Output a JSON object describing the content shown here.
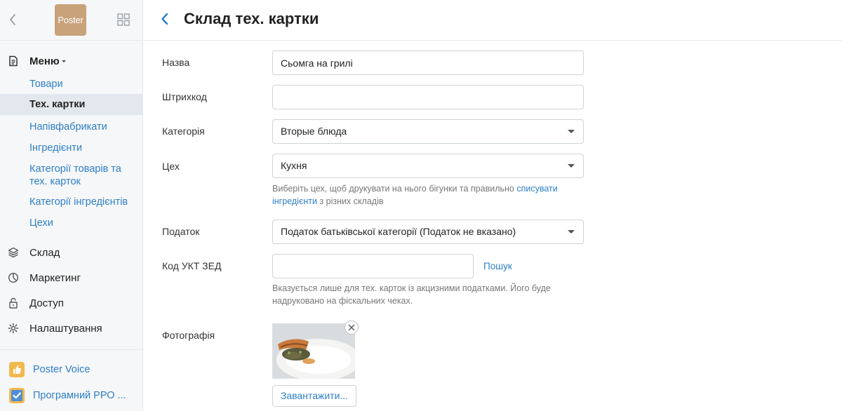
{
  "sidebar": {
    "logo_text": "Poster",
    "sections": {
      "menu": "Меню",
      "warehouse": "Склад",
      "marketing": "Маркетинг",
      "access": "Доступ",
      "settings": "Налаштування"
    },
    "menu_items": [
      "Товари",
      "Тех. картки",
      "Напівфабрикати",
      "Інгредієнти",
      "Категорії товарів та тех. карток",
      "Категорії інгредієнтів",
      "Цехи"
    ],
    "active_item": "Тех. картки",
    "apps": {
      "poster_voice": "Poster Voice",
      "prro": "Програмний РРО ..."
    }
  },
  "header": {
    "title": "Склад тех. картки"
  },
  "form": {
    "name": {
      "label": "Назва",
      "value": "Сьомга на грилі"
    },
    "barcode": {
      "label": "Штрихкод",
      "value": ""
    },
    "category": {
      "label": "Категорія",
      "value": "Вторые блюда"
    },
    "workshop": {
      "label": "Цех",
      "value": "Кухня",
      "hint_before": "Виберіть цех, щоб друкувати на нього бігунки та правильно ",
      "hint_link": "списувати інгредієнти",
      "hint_after": " з різних складів"
    },
    "tax": {
      "label": "Податок",
      "value": "Податок батьківської категорії (Податок не вказано)"
    },
    "ukt_zed": {
      "label": "Код УКТ ЗЕД",
      "value": "",
      "search_link": "Пошук",
      "hint": "Вказується лише для тех. карток із акцизними податками. Його буде надруковано на фіскальних чеках."
    },
    "photo": {
      "label": "Фотографія",
      "upload_button": "Завантажити..."
    }
  },
  "colors": {
    "accent": "#2d7fc8",
    "sidebar_bg": "#f6f7f8",
    "active_bg": "#e3e8ee",
    "logo": "#c8a27a",
    "voice_icon": "#f1b94c",
    "prro_icon": "#f1b94c"
  },
  "icons": {
    "back": "chevron-left-icon",
    "grid": "grid-icon",
    "menu": "document-icon",
    "warehouse": "layers-icon",
    "marketing": "pie-icon",
    "access": "lock-icon",
    "settings": "gear-icon",
    "poster_voice": "thumbs-up-icon",
    "prro": "checkbox-icon",
    "photo_remove": "close-icon",
    "select_caret": "caret-down-icon"
  }
}
